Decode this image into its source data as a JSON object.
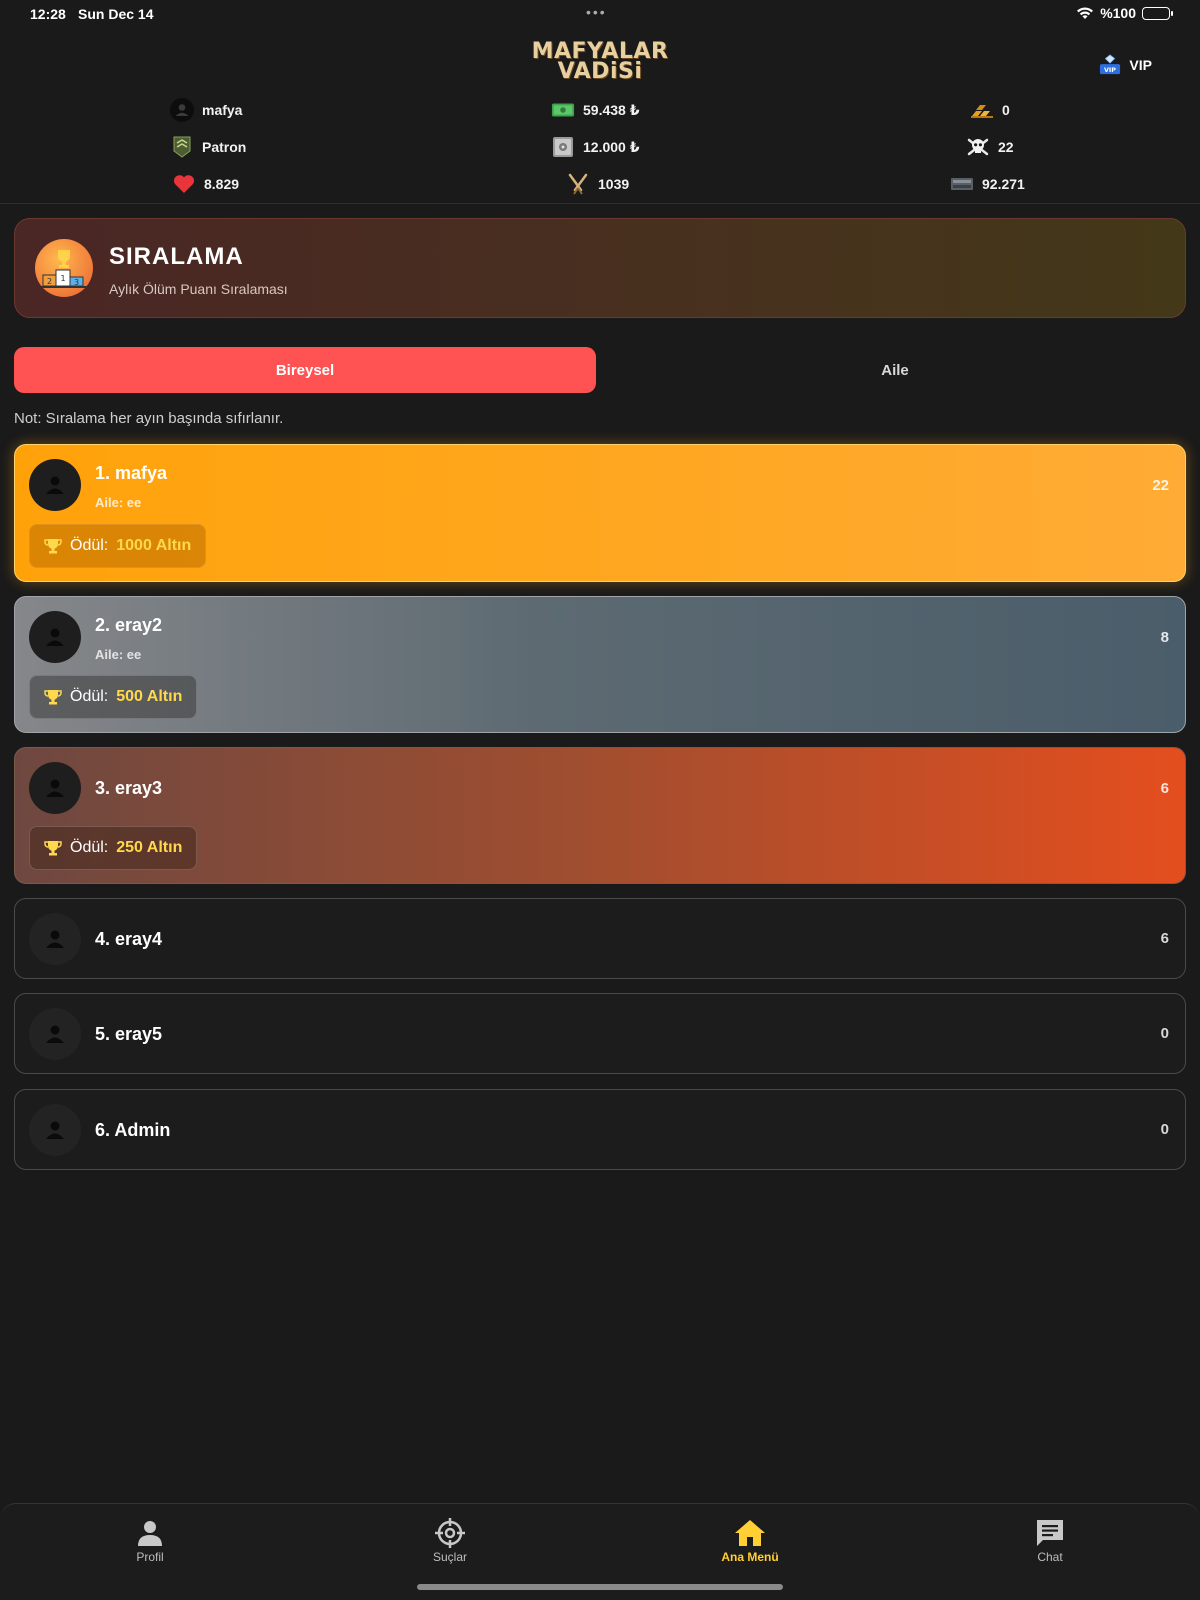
{
  "status_bar": {
    "time": "12:28",
    "date": "Sun Dec 14",
    "battery": "%100"
  },
  "header": {
    "logo_line1": "MAFYALAR",
    "logo_line2": "VADiSi",
    "vip_label": "VIP"
  },
  "stats": {
    "username": "mafya",
    "money": "59.438 ₺",
    "gold": "0",
    "rank": "Patron",
    "bank": "12.000 ₺",
    "kills": "22",
    "health": "8.829",
    "power": "1039",
    "ammo": "92.271"
  },
  "banner": {
    "title": "SIRALAMA",
    "subtitle": "Aylık Ölüm Puanı Sıralaması"
  },
  "tabs": [
    {
      "label": "Bireysel",
      "active": true
    },
    {
      "label": "Aile",
      "active": false
    }
  ],
  "note": "Not: Sıralama her ayın başında sıfırlanır.",
  "rankings": [
    {
      "name": "1. mafya",
      "family": "Aile: ee",
      "score": "22",
      "reward_label": "Ödül:",
      "reward_amount": "1000 Altın"
    },
    {
      "name": "2. eray2",
      "family": "Aile: ee",
      "score": "8",
      "reward_label": "Ödül:",
      "reward_amount": "500 Altın"
    },
    {
      "name": "3. eray3",
      "score": "6",
      "reward_label": "Ödül:",
      "reward_amount": "250 Altın"
    },
    {
      "name": "4. eray4",
      "score": "6"
    },
    {
      "name": "5. eray5",
      "score": "0"
    },
    {
      "name": "6. Admin",
      "score": "0"
    }
  ],
  "nav": [
    {
      "label": "Profil",
      "icon": "person-icon"
    },
    {
      "label": "Suçlar",
      "icon": "crosshair-icon"
    },
    {
      "label": "Ana Menü",
      "icon": "home-icon",
      "active": true
    },
    {
      "label": "Chat",
      "icon": "chat-icon"
    }
  ],
  "colors": {
    "background": "#1a1a1a",
    "accent": "#ff5252",
    "gold": "#ffd84d",
    "nav_active": "#ffcf33"
  }
}
